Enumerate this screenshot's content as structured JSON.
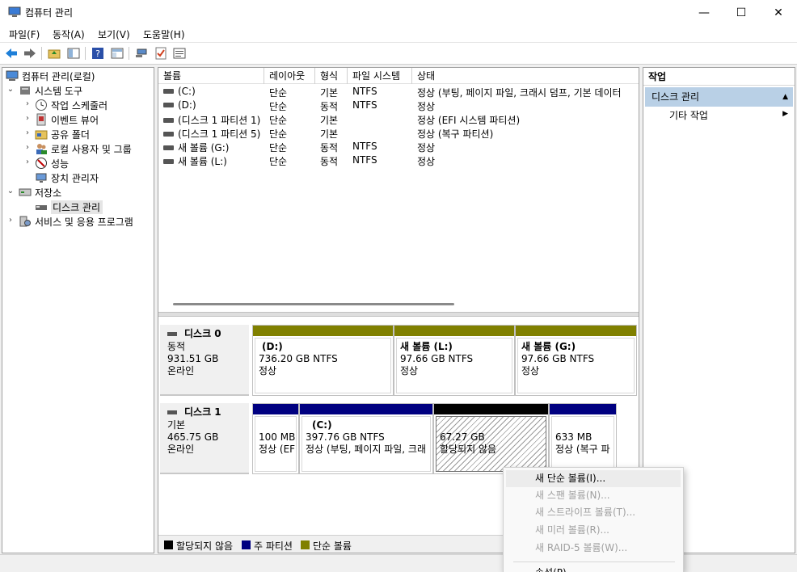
{
  "window": {
    "title": "컴퓨터 관리",
    "minimize": "—",
    "maximize": "☐",
    "close": "✕"
  },
  "menu": [
    "파일(F)",
    "동작(A)",
    "보기(V)",
    "도움말(H)"
  ],
  "tree": {
    "root": "컴퓨터 관리(로컬)",
    "system_tools": "시스템 도구",
    "task_scheduler": "작업 스케줄러",
    "event_viewer": "이벤트 뷰어",
    "shared_folders": "공유 폴더",
    "local_users": "로컬 사용자 및 그룹",
    "performance": "성능",
    "device_manager": "장치 관리자",
    "storage": "저장소",
    "disk_management": "디스크 관리",
    "services": "서비스 및 응용 프로그램"
  },
  "volume_list": {
    "columns": [
      "볼륨",
      "레이아웃",
      "형식",
      "파일 시스템",
      "상태"
    ],
    "rows": [
      {
        "volume": "(C:)",
        "layout": "단순",
        "type": "기본",
        "fs": "NTFS",
        "status": "정상 (부팅, 페이지 파일, 크래시 덤프, 기본 데이터"
      },
      {
        "volume": "(D:)",
        "layout": "단순",
        "type": "동적",
        "fs": "NTFS",
        "status": "정상"
      },
      {
        "volume": "(디스크 1 파티션 1)",
        "layout": "단순",
        "type": "기본",
        "fs": "",
        "status": "정상 (EFI 시스템 파티션)"
      },
      {
        "volume": "(디스크 1 파티션 5)",
        "layout": "단순",
        "type": "기본",
        "fs": "",
        "status": "정상 (복구 파티션)"
      },
      {
        "volume": "새 볼륨 (G:)",
        "layout": "단순",
        "type": "동적",
        "fs": "NTFS",
        "status": "정상"
      },
      {
        "volume": "새 볼륨 (L:)",
        "layout": "단순",
        "type": "동적",
        "fs": "NTFS",
        "status": "정상"
      }
    ]
  },
  "disks": [
    {
      "name": "디스크 0",
      "type": "동적",
      "size": "931.51 GB",
      "state": "온라인",
      "partitions": [
        {
          "title": "(D:)",
          "line1": "736.20 GB NTFS",
          "line2": "정상",
          "bar": "#808000"
        },
        {
          "title": "새 볼륨  (L:)",
          "line1": "97.66 GB NTFS",
          "line2": "정상",
          "bar": "#808000"
        },
        {
          "title": "새 볼륨  (G:)",
          "line1": "97.66 GB NTFS",
          "line2": "정상",
          "bar": "#808000"
        }
      ]
    },
    {
      "name": "디스크 1",
      "type": "기본",
      "size": "465.75 GB",
      "state": "온라인",
      "partitions": [
        {
          "title": "",
          "line1": "100 MB",
          "line2": "정상 (EFI",
          "bar": "#000080"
        },
        {
          "title": "(C:)",
          "line1": "397.76 GB NTFS",
          "line2": "정상 (부팅, 페이지 파일, 크래",
          "bar": "#000080"
        },
        {
          "title": "",
          "line1": "67.27 GB",
          "line2": "할당되지 않음",
          "bar": "#000000"
        },
        {
          "title": "",
          "line1": "633 MB",
          "line2": "정상 (복구 파",
          "bar": "#000080"
        }
      ]
    }
  ],
  "legend": [
    {
      "label": "할당되지 않음",
      "color": "#000000"
    },
    {
      "label": "주 파티션",
      "color": "#000080"
    },
    {
      "label": "단순 볼륨",
      "color": "#808000"
    }
  ],
  "actions": {
    "header": "작업",
    "group": "디스크 관리",
    "more": "기타 작업"
  },
  "context_menu": [
    {
      "label": "새 단순 볼륨(I)...",
      "enabled": true
    },
    {
      "label": "새 스팬 볼륨(N)...",
      "enabled": false
    },
    {
      "label": "새 스트라이프 볼륨(T)...",
      "enabled": false
    },
    {
      "label": "새 미러 볼륨(R)...",
      "enabled": false
    },
    {
      "label": "새 RAID-5 볼륨(W)...",
      "enabled": false
    },
    {
      "label": "속성(P)",
      "enabled": true
    }
  ]
}
